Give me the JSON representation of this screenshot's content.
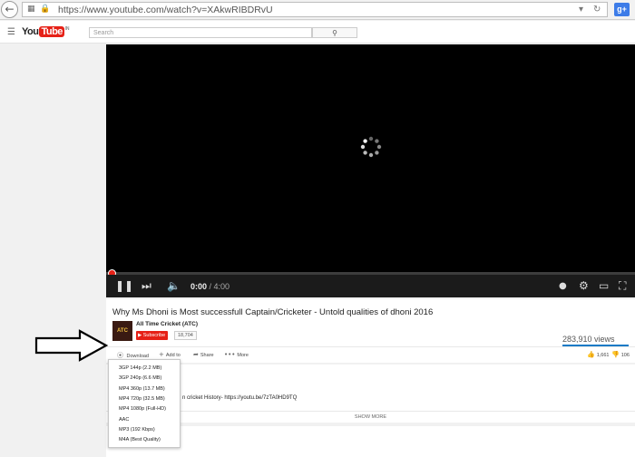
{
  "browser": {
    "url": "https://www.youtube.com/watch?v=XAkwRIBDRvU",
    "extension_label": "g+"
  },
  "youtube": {
    "logo_you": "You",
    "logo_tube": "Tube",
    "logo_country": "IN",
    "search_placeholder": "Search"
  },
  "player": {
    "current_time": "0:00",
    "duration": "/ 4:00",
    "progress": 0
  },
  "video": {
    "title": "Why Ms Dhoni is Most successfull Captain/Cricketer - Untold qualities of dhoni 2016",
    "channel": "All Time Cricket (ATC)",
    "subscribe_label": "Subscribe",
    "subscriber_count": "18,704",
    "views": "283,910 views",
    "likes": "1,661",
    "dislikes": "106"
  },
  "actions": {
    "download": "Download",
    "add_to": "Add to",
    "share": "Share",
    "more": "More"
  },
  "description": {
    "text": "n cricket History- https://youtu.be/7zTA0HD9TQ",
    "show_more": "SHOW MORE"
  },
  "download_menu": {
    "items": [
      "3GP 144p (2.2 MB)",
      "3GP 240p (6.6 MB)",
      "MP4 360p (13.7 MB)",
      "MP4 720p (32.5 MB)",
      "MP4 1080p (Full-HD)",
      "AAC",
      "MP3 (192 Kbps)",
      "M4A (Best Quality)"
    ]
  },
  "colors": {
    "youtube_red": "#e62117",
    "views_blue": "#167ac6",
    "player_bg": "#000000"
  }
}
